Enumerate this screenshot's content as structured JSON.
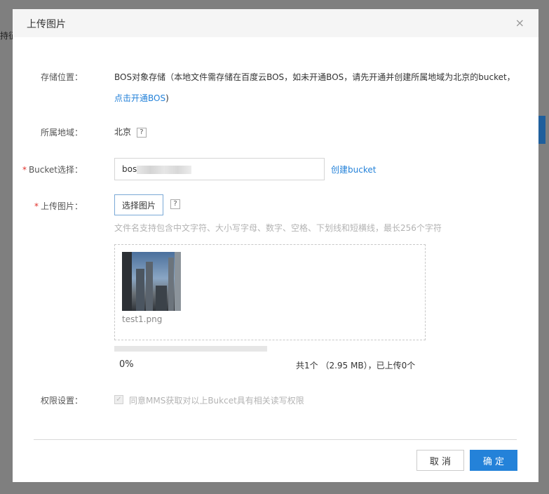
{
  "background": {
    "partial_text": "持征"
  },
  "dialog": {
    "title": "上传图片",
    "close_label": "×"
  },
  "storage": {
    "label": "存储位置：",
    "description": "BOS对象存储（本地文件需存储在百度云BOS，如未开通BOS，请先开通并创建所属地域为北京的bucket，",
    "link_text": "点击开通BOS",
    "close_paren": ")"
  },
  "region": {
    "label": "所属地域：",
    "value": "北京",
    "help": "?"
  },
  "bucket": {
    "required_mark": "*",
    "label": "Bucket选择：",
    "value": "bos",
    "create_link": "创建bucket"
  },
  "upload": {
    "required_mark": "*",
    "label": "上传图片：",
    "choose_button": "选择图片",
    "help": "?",
    "hint": "文件名支持包含中文字符、大小写字母、数字、空格、下划线和短横线，最长256个字符",
    "file_name": "test1.png",
    "progress": 0,
    "percent_text": "0%",
    "summary": "共1个 （2.95 MB），已上传0个"
  },
  "permission": {
    "label": "权限设置：",
    "checkbox_text": "同意MMS获取对以上Bukcet具有相关读写权限",
    "checked": true
  },
  "footer": {
    "cancel": "取 消",
    "ok": "确 定"
  },
  "colors": {
    "primary": "#2482d9",
    "required": "#e0312a",
    "overlay": "#7f7f7f"
  }
}
